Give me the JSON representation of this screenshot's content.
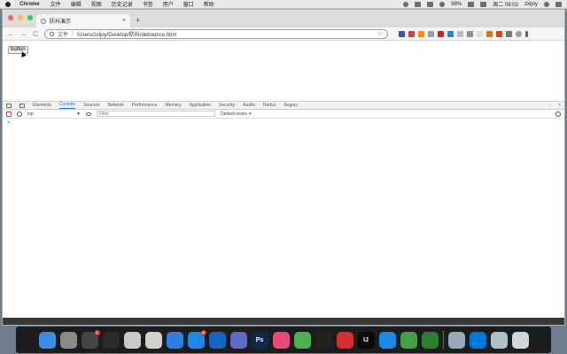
{
  "menubar": {
    "app_name": "Chrome",
    "items": [
      "文件",
      "编辑",
      "视图",
      "历史记录",
      "书签",
      "用户",
      "窗口",
      "帮助"
    ],
    "battery": "98%",
    "clock": "周二 09:02",
    "user": "zxljoy"
  },
  "tab": {
    "title": "防抖演示",
    "close": "×"
  },
  "newtab": "+",
  "toolbar": {
    "back": "←",
    "forward": "→",
    "reload": "C",
    "scheme_label": "文件",
    "separator": "|",
    "url": "/Users/zxljoy/Desktop/防抖/debounce.html",
    "star": "☆"
  },
  "page": {
    "button_label": "button"
  },
  "devtools": {
    "tabs": [
      "Elements",
      "Console",
      "Sources",
      "Network",
      "Performance",
      "Memory",
      "Application",
      "Security",
      "Audits",
      "Redux",
      "Augury"
    ],
    "active_tab": "Console",
    "context": "top",
    "context_arrow": "▼",
    "filter_placeholder": "Filter",
    "levels": "Default levels",
    "levels_arrow": "▾",
    "prompt": ">",
    "more": "⋮",
    "close": "×"
  },
  "dock": {
    "apps": [
      {
        "name": "finder",
        "label": "",
        "color": "#3b8de0"
      },
      {
        "name": "launchpad",
        "label": "",
        "color": "#8a8a8a"
      },
      {
        "name": "qq",
        "label": "",
        "color": "#444444",
        "badge": "1"
      },
      {
        "name": "activity",
        "label": "",
        "color": "#2a2a2a"
      },
      {
        "name": "preview",
        "label": "",
        "color": "#c9c9c9"
      },
      {
        "name": "tools",
        "label": "",
        "color": "#d0d0d0"
      },
      {
        "name": "safari",
        "label": "",
        "color": "#2f7fdc"
      },
      {
        "name": "appstore",
        "label": "",
        "color": "#1e88e5",
        "badge": "8"
      },
      {
        "name": "xcode",
        "label": "",
        "color": "#1565c0"
      },
      {
        "name": "qqbrowser",
        "label": "",
        "color": "#5c6bc0"
      },
      {
        "name": "photoshop",
        "label": "Ps",
        "color": "#0d2a4a"
      },
      {
        "name": "itunes",
        "label": "",
        "color": "#e84a77"
      },
      {
        "name": "chrome",
        "label": "",
        "color": "#4caf50"
      },
      {
        "name": "terminal",
        "label": "",
        "color": "#222222"
      },
      {
        "name": "netease",
        "label": "",
        "color": "#d32f2f"
      },
      {
        "name": "intellij",
        "label": "IJ",
        "color": "#0a0a0a"
      },
      {
        "name": "vscode",
        "label": "",
        "color": "#1e88e5"
      },
      {
        "name": "wechat-dev",
        "label": "",
        "color": "#43a047"
      },
      {
        "name": "wechat",
        "label": "",
        "color": "#2e7d32"
      },
      {
        "name": "divider"
      },
      {
        "name": "disk",
        "label": "",
        "color": "#9aa8b7"
      },
      {
        "name": "edge",
        "label": "",
        "color": "#0078d7"
      },
      {
        "name": "downloads",
        "label": "",
        "color": "#b0bec5"
      },
      {
        "name": "trash",
        "label": "",
        "color": "#cfd8dc"
      }
    ]
  },
  "colors": {
    "traffic_close": "#fc605c",
    "traffic_min": "#fdbc40",
    "traffic_max": "#34c84a",
    "active_tab": "#1a73e8",
    "omnibox_border": "#7aa7e8"
  }
}
